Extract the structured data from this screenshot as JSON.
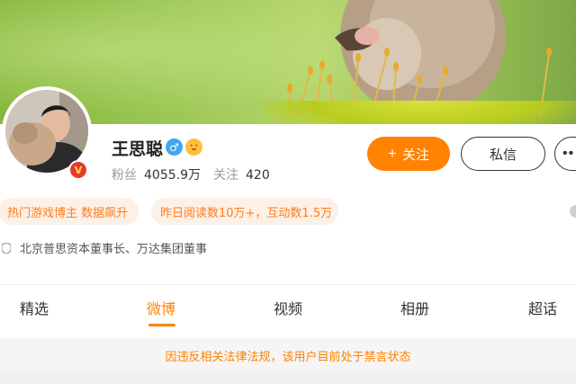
{
  "profile": {
    "name": "王思聪",
    "gender_icon": "male-icon",
    "gender_glyph": "♂",
    "emoji_icon": "heart-eyes-emoji-icon",
    "verified_glyph": "V",
    "fans_label": "粉丝",
    "fans_value": "4055.9万",
    "following_label": "关注",
    "following_value": "420"
  },
  "actions": {
    "follow_plus": "+",
    "follow_label": "关注",
    "message_label": "私信",
    "more_label": "••"
  },
  "tags": [
    "热门游戏博主 数据飙升",
    "昨日阅读数10万+，互动数1.5万"
  ],
  "bio": "北京普思资本董事长、万达集团董事",
  "tabs": [
    {
      "label": "精选",
      "active": false
    },
    {
      "label": "微博",
      "active": true
    },
    {
      "label": "视频",
      "active": false
    },
    {
      "label": "相册",
      "active": false
    },
    {
      "label": "超话",
      "active": false
    }
  ],
  "notice": "因违反相关法律法规，该用户目前处于禁言状态",
  "colors": {
    "accent": "#ff8200",
    "tag_bg": "#fdf0e6",
    "verified": "#e53a2f",
    "gender": "#3fa7ee"
  }
}
